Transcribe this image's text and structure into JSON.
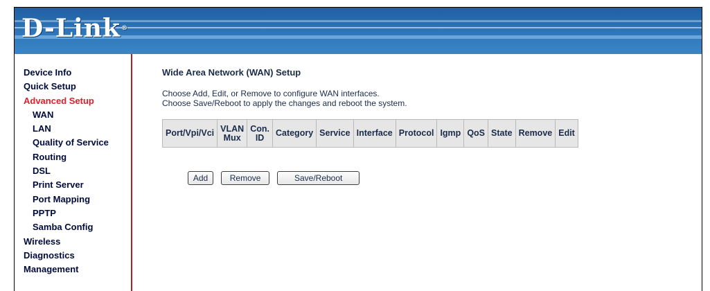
{
  "brand": {
    "logo_text": "D-Link",
    "trademark": "®"
  },
  "sidebar": {
    "items": [
      {
        "label": "Device Info",
        "level": 0,
        "active": false
      },
      {
        "label": "Quick Setup",
        "level": 0,
        "active": false
      },
      {
        "label": "Advanced Setup",
        "level": 0,
        "active": true
      },
      {
        "label": "WAN",
        "level": 1,
        "active": false
      },
      {
        "label": "LAN",
        "level": 1,
        "active": false
      },
      {
        "label": "Quality of Service",
        "level": 1,
        "active": false
      },
      {
        "label": "Routing",
        "level": 1,
        "active": false
      },
      {
        "label": "DSL",
        "level": 1,
        "active": false
      },
      {
        "label": "Print Server",
        "level": 1,
        "active": false
      },
      {
        "label": "Port Mapping",
        "level": 1,
        "active": false
      },
      {
        "label": "PPTP",
        "level": 1,
        "active": false
      },
      {
        "label": "Samba Config",
        "level": 1,
        "active": false
      },
      {
        "label": "Wireless",
        "level": 0,
        "active": false
      },
      {
        "label": "Diagnostics",
        "level": 0,
        "active": false
      },
      {
        "label": "Management",
        "level": 0,
        "active": false
      }
    ]
  },
  "main": {
    "title": "Wide Area Network (WAN) Setup",
    "description_line1": "Choose Add, Edit, or Remove to configure WAN interfaces.",
    "description_line2": "Choose Save/Reboot to apply the changes and reboot the system.",
    "table": {
      "columns": [
        {
          "line1": "Port/Vpi/Vci",
          "line2": ""
        },
        {
          "line1": "VLAN",
          "line2": "Mux"
        },
        {
          "line1": "Con.",
          "line2": "ID"
        },
        {
          "line1": "Category",
          "line2": ""
        },
        {
          "line1": "Service",
          "line2": ""
        },
        {
          "line1": "Interface",
          "line2": ""
        },
        {
          "line1": "Protocol",
          "line2": ""
        },
        {
          "line1": "Igmp",
          "line2": ""
        },
        {
          "line1": "QoS",
          "line2": ""
        },
        {
          "line1": "State",
          "line2": ""
        },
        {
          "line1": "Remove",
          "line2": ""
        },
        {
          "line1": "Edit",
          "line2": ""
        }
      ],
      "rows": []
    },
    "buttons": {
      "add_label": "Add",
      "remove_label": "Remove",
      "save_reboot_label": "Save/Reboot"
    }
  },
  "colors": {
    "banner_blue": "#2d73b5",
    "active_nav": "#e01e2b",
    "nav_text": "#000a3c",
    "sidebar_divider": "#b0202b",
    "header_bg": "#e6e6e6"
  }
}
